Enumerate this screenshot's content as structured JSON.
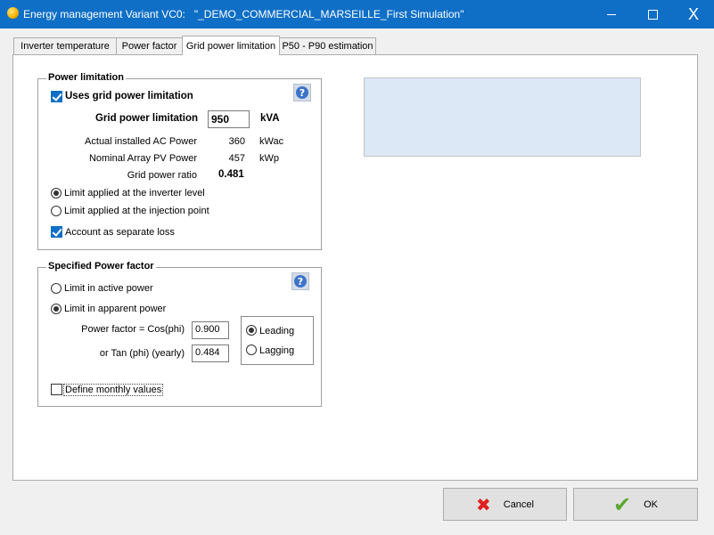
{
  "window": {
    "title": "Energy management Variant VC0:   \"_DEMO_COMMERCIAL_MARSEILLE_First Simulation\"",
    "minimize_icon": "minimize-icon",
    "maximize_icon": "maximize-icon",
    "close_glyph": "X"
  },
  "tabs": [
    {
      "label": "Inverter temperature"
    },
    {
      "label": "Power factor"
    },
    {
      "label": "Grid power limitation"
    },
    {
      "label": "P50 - P90 estimation"
    }
  ],
  "active_tab": "Grid power limitation",
  "power_limitation": {
    "title": "Power limitation",
    "uses_limitation_label": "Uses grid power limitation",
    "uses_limitation_checked": true,
    "grid_limit_label": "Grid power limitation",
    "grid_limit_value": "950",
    "grid_limit_unit": "kVA",
    "ac_power_label": "Actual installed AC Power",
    "ac_power_value": "360",
    "ac_power_unit": "kWac",
    "pv_power_label": "Nominal Array PV Power",
    "pv_power_value": "457",
    "pv_power_unit": "kWp",
    "ratio_label": "Grid power ratio",
    "ratio_value": "0.481",
    "radio_inverter_label": "Limit applied at the inverter level",
    "radio_inverter_checked": true,
    "radio_injection_label": "Limit applied at the injection point",
    "radio_injection_checked": false,
    "separate_loss_label": "Account as separate loss",
    "separate_loss_checked": true,
    "help_glyph": "?"
  },
  "power_factor": {
    "title": "Specified Power factor",
    "active_power_label": "Limit in active power",
    "active_power_checked": false,
    "apparent_power_label": "Limit in apparent power",
    "apparent_power_checked": true,
    "cos_phi_label": "Power factor = Cos(phi)",
    "cos_phi_value": "0.900",
    "tan_phi_label": "or Tan (phi) (yearly)",
    "tan_phi_value": "0.484",
    "leading_label": "Leading",
    "leading_checked": true,
    "lagging_label": "Lagging",
    "lagging_checked": false,
    "monthly_label": "Define monthly values",
    "monthly_checked": false,
    "help_glyph": "?"
  },
  "buttons": {
    "cancel_label": "Cancel",
    "ok_label": "OK",
    "cancel_icon": "red-x-icon",
    "ok_icon": "green-check-icon",
    "cancel_color": "#e02020",
    "ok_color": "#5aa832"
  }
}
